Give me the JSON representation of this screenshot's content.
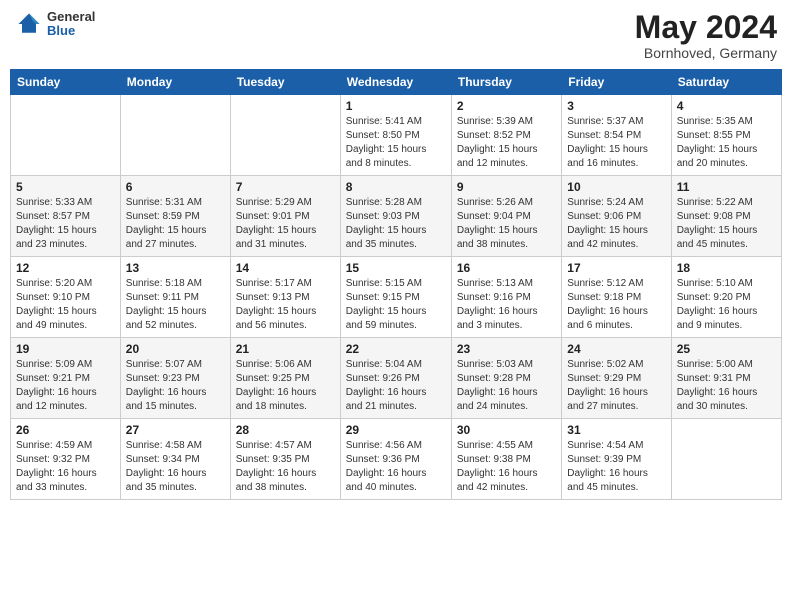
{
  "header": {
    "logo_general": "General",
    "logo_blue": "Blue",
    "month_title": "May 2024",
    "location": "Bornhoved, Germany"
  },
  "weekdays": [
    "Sunday",
    "Monday",
    "Tuesday",
    "Wednesday",
    "Thursday",
    "Friday",
    "Saturday"
  ],
  "weeks": [
    [
      {
        "day": "",
        "info": ""
      },
      {
        "day": "",
        "info": ""
      },
      {
        "day": "",
        "info": ""
      },
      {
        "day": "1",
        "info": "Sunrise: 5:41 AM\nSunset: 8:50 PM\nDaylight: 15 hours\nand 8 minutes."
      },
      {
        "day": "2",
        "info": "Sunrise: 5:39 AM\nSunset: 8:52 PM\nDaylight: 15 hours\nand 12 minutes."
      },
      {
        "day": "3",
        "info": "Sunrise: 5:37 AM\nSunset: 8:54 PM\nDaylight: 15 hours\nand 16 minutes."
      },
      {
        "day": "4",
        "info": "Sunrise: 5:35 AM\nSunset: 8:55 PM\nDaylight: 15 hours\nand 20 minutes."
      }
    ],
    [
      {
        "day": "5",
        "info": "Sunrise: 5:33 AM\nSunset: 8:57 PM\nDaylight: 15 hours\nand 23 minutes."
      },
      {
        "day": "6",
        "info": "Sunrise: 5:31 AM\nSunset: 8:59 PM\nDaylight: 15 hours\nand 27 minutes."
      },
      {
        "day": "7",
        "info": "Sunrise: 5:29 AM\nSunset: 9:01 PM\nDaylight: 15 hours\nand 31 minutes."
      },
      {
        "day": "8",
        "info": "Sunrise: 5:28 AM\nSunset: 9:03 PM\nDaylight: 15 hours\nand 35 minutes."
      },
      {
        "day": "9",
        "info": "Sunrise: 5:26 AM\nSunset: 9:04 PM\nDaylight: 15 hours\nand 38 minutes."
      },
      {
        "day": "10",
        "info": "Sunrise: 5:24 AM\nSunset: 9:06 PM\nDaylight: 15 hours\nand 42 minutes."
      },
      {
        "day": "11",
        "info": "Sunrise: 5:22 AM\nSunset: 9:08 PM\nDaylight: 15 hours\nand 45 minutes."
      }
    ],
    [
      {
        "day": "12",
        "info": "Sunrise: 5:20 AM\nSunset: 9:10 PM\nDaylight: 15 hours\nand 49 minutes."
      },
      {
        "day": "13",
        "info": "Sunrise: 5:18 AM\nSunset: 9:11 PM\nDaylight: 15 hours\nand 52 minutes."
      },
      {
        "day": "14",
        "info": "Sunrise: 5:17 AM\nSunset: 9:13 PM\nDaylight: 15 hours\nand 56 minutes."
      },
      {
        "day": "15",
        "info": "Sunrise: 5:15 AM\nSunset: 9:15 PM\nDaylight: 15 hours\nand 59 minutes."
      },
      {
        "day": "16",
        "info": "Sunrise: 5:13 AM\nSunset: 9:16 PM\nDaylight: 16 hours\nand 3 minutes."
      },
      {
        "day": "17",
        "info": "Sunrise: 5:12 AM\nSunset: 9:18 PM\nDaylight: 16 hours\nand 6 minutes."
      },
      {
        "day": "18",
        "info": "Sunrise: 5:10 AM\nSunset: 9:20 PM\nDaylight: 16 hours\nand 9 minutes."
      }
    ],
    [
      {
        "day": "19",
        "info": "Sunrise: 5:09 AM\nSunset: 9:21 PM\nDaylight: 16 hours\nand 12 minutes."
      },
      {
        "day": "20",
        "info": "Sunrise: 5:07 AM\nSunset: 9:23 PM\nDaylight: 16 hours\nand 15 minutes."
      },
      {
        "day": "21",
        "info": "Sunrise: 5:06 AM\nSunset: 9:25 PM\nDaylight: 16 hours\nand 18 minutes."
      },
      {
        "day": "22",
        "info": "Sunrise: 5:04 AM\nSunset: 9:26 PM\nDaylight: 16 hours\nand 21 minutes."
      },
      {
        "day": "23",
        "info": "Sunrise: 5:03 AM\nSunset: 9:28 PM\nDaylight: 16 hours\nand 24 minutes."
      },
      {
        "day": "24",
        "info": "Sunrise: 5:02 AM\nSunset: 9:29 PM\nDaylight: 16 hours\nand 27 minutes."
      },
      {
        "day": "25",
        "info": "Sunrise: 5:00 AM\nSunset: 9:31 PM\nDaylight: 16 hours\nand 30 minutes."
      }
    ],
    [
      {
        "day": "26",
        "info": "Sunrise: 4:59 AM\nSunset: 9:32 PM\nDaylight: 16 hours\nand 33 minutes."
      },
      {
        "day": "27",
        "info": "Sunrise: 4:58 AM\nSunset: 9:34 PM\nDaylight: 16 hours\nand 35 minutes."
      },
      {
        "day": "28",
        "info": "Sunrise: 4:57 AM\nSunset: 9:35 PM\nDaylight: 16 hours\nand 38 minutes."
      },
      {
        "day": "29",
        "info": "Sunrise: 4:56 AM\nSunset: 9:36 PM\nDaylight: 16 hours\nand 40 minutes."
      },
      {
        "day": "30",
        "info": "Sunrise: 4:55 AM\nSunset: 9:38 PM\nDaylight: 16 hours\nand 42 minutes."
      },
      {
        "day": "31",
        "info": "Sunrise: 4:54 AM\nSunset: 9:39 PM\nDaylight: 16 hours\nand 45 minutes."
      },
      {
        "day": "",
        "info": ""
      }
    ]
  ]
}
